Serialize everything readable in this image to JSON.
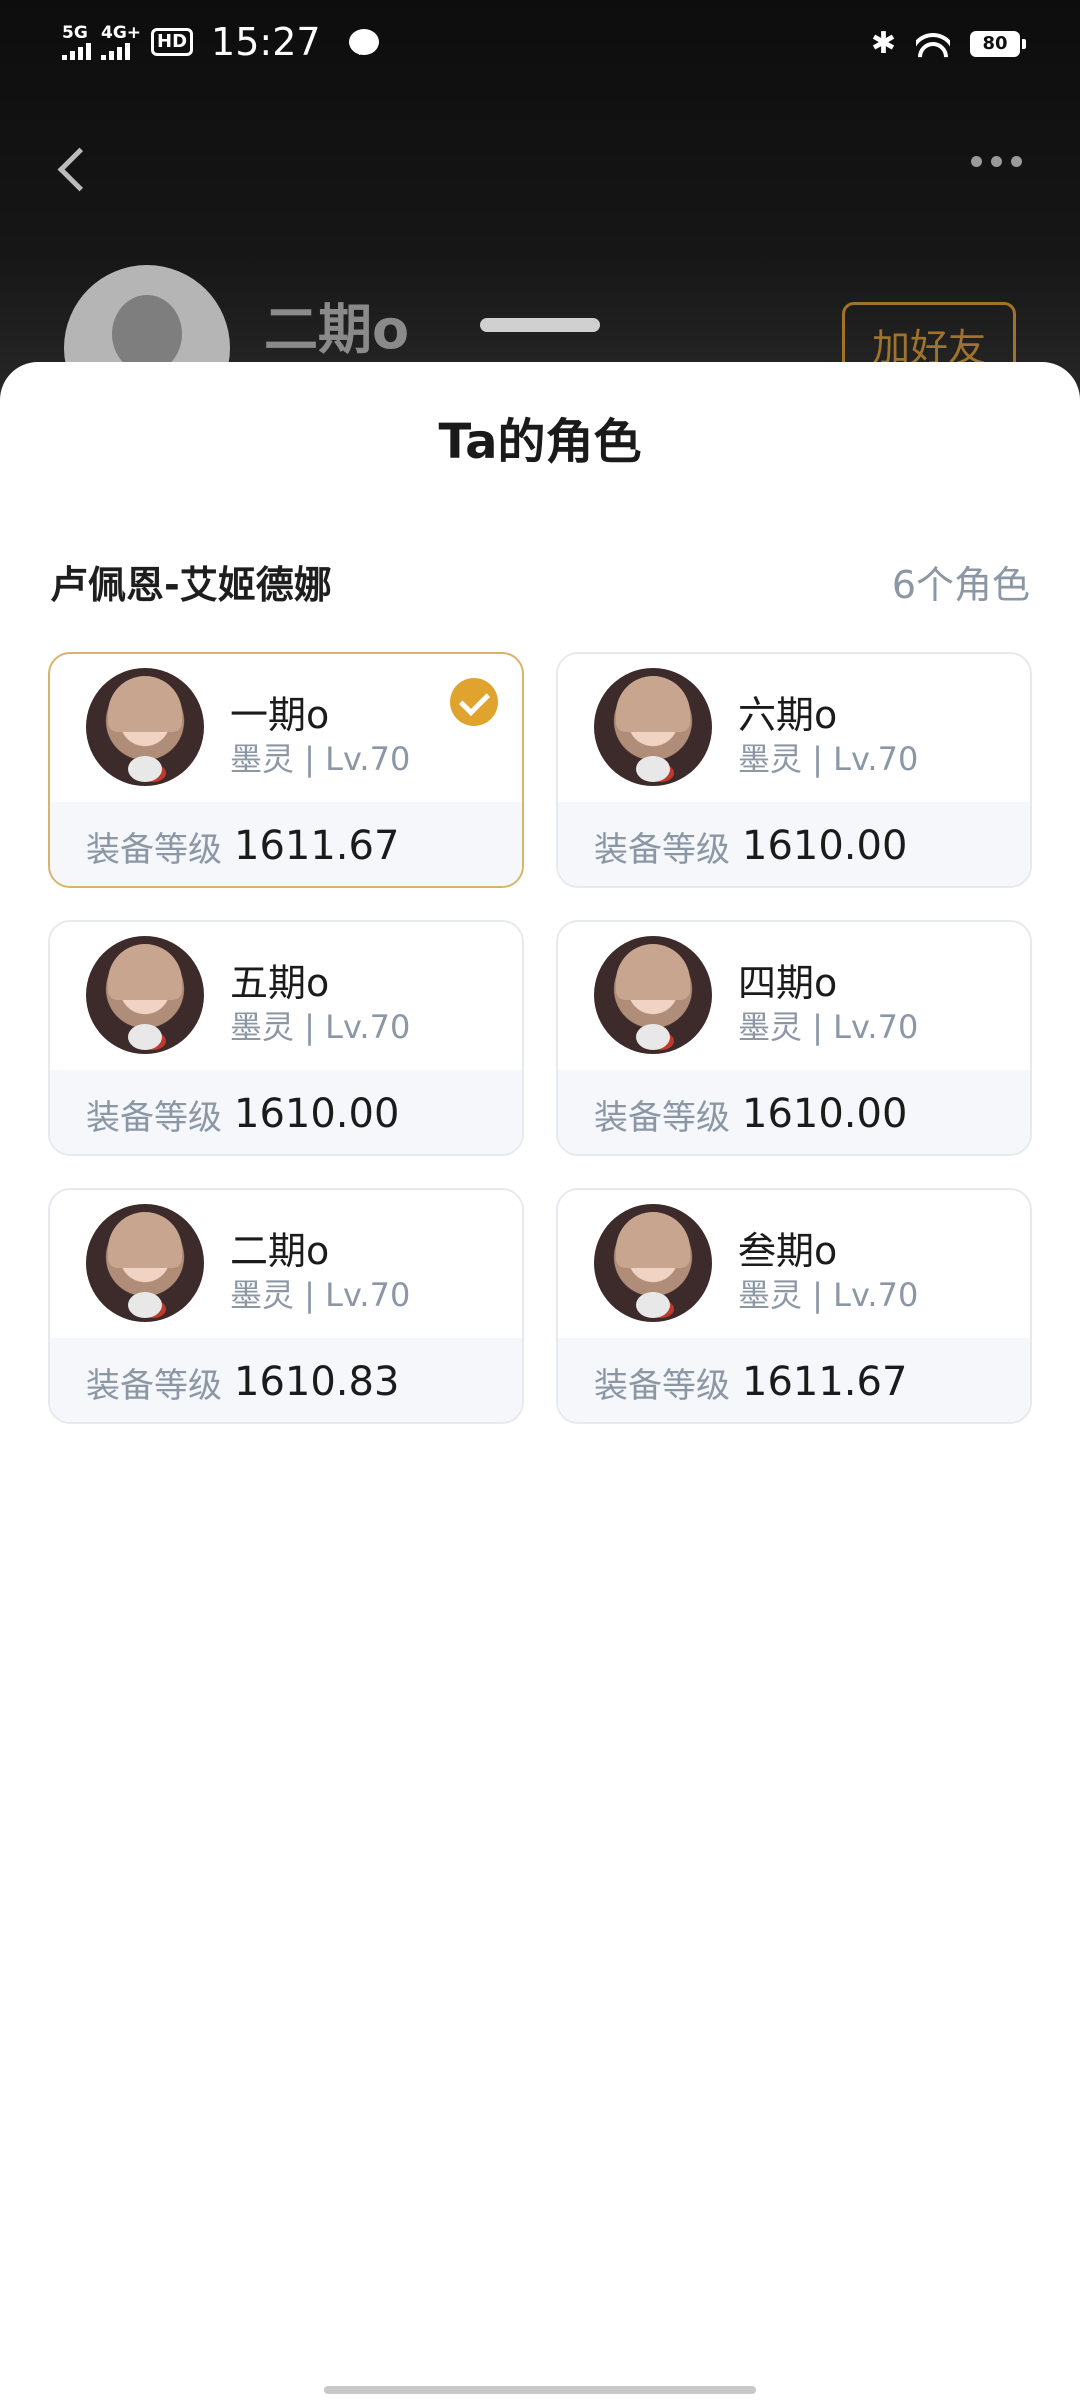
{
  "status_bar": {
    "signal1_label": "5G",
    "signal2_label": "4G+",
    "hd_label": "HD",
    "time": "15:27",
    "battery": "80"
  },
  "profile": {
    "name": "二期o",
    "add_friend_label": "加好友"
  },
  "sheet": {
    "title": "Ta的角色",
    "server_name": "卢佩恩-艾姬德娜",
    "role_count": "6个角色"
  },
  "characters": [
    {
      "name": "一期o",
      "class_level": "墨灵 | Lv.70",
      "gear_label": "装备等级",
      "gear_score": "1611.67",
      "selected": true
    },
    {
      "name": "六期o",
      "class_level": "墨灵 | Lv.70",
      "gear_label": "装备等级",
      "gear_score": "1610.00",
      "selected": false
    },
    {
      "name": "五期o",
      "class_level": "墨灵 | Lv.70",
      "gear_label": "装备等级",
      "gear_score": "1610.00",
      "selected": false
    },
    {
      "name": "四期o",
      "class_level": "墨灵 | Lv.70",
      "gear_label": "装备等级",
      "gear_score": "1610.00",
      "selected": false
    },
    {
      "name": "二期o",
      "class_level": "墨灵 | Lv.70",
      "gear_label": "装备等级",
      "gear_score": "1610.83",
      "selected": false
    },
    {
      "name": "叁期o",
      "class_level": "墨灵 | Lv.70",
      "gear_label": "装备等级",
      "gear_score": "1611.67",
      "selected": false
    }
  ],
  "colors": {
    "accent": "#e0a32e",
    "selected_border": "#d8b36a",
    "muted_text": "#8c97a6"
  }
}
